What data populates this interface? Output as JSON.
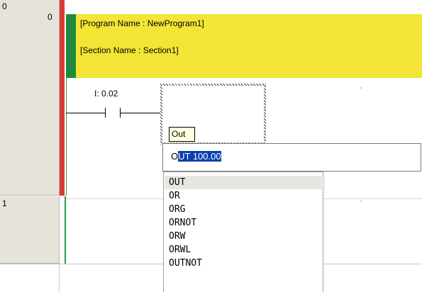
{
  "rungs": [
    {
      "index_top": "0",
      "index_sub": "0"
    },
    {
      "index_top": "1"
    }
  ],
  "comment": {
    "program_name": "[Program Name : NewProgram1]",
    "section_name": "[Section Name : Section1]"
  },
  "contact": {
    "address": "I: 0.02"
  },
  "tooltip": {
    "text": "Out"
  },
  "instruction_input": {
    "typed": "O",
    "suggested": "UT 100.00"
  },
  "autocomplete": {
    "items": [
      "OUT",
      "OR",
      "ORG",
      "ORNOT",
      "ORW",
      "ORWL",
      "OUTNOT"
    ],
    "selected_index": 0
  },
  "colors": {
    "comment_bg": "#f2e535",
    "rail_red": "#d83a34",
    "rail_green": "#2c9c44",
    "selection_highlight": "#0a3fae"
  }
}
